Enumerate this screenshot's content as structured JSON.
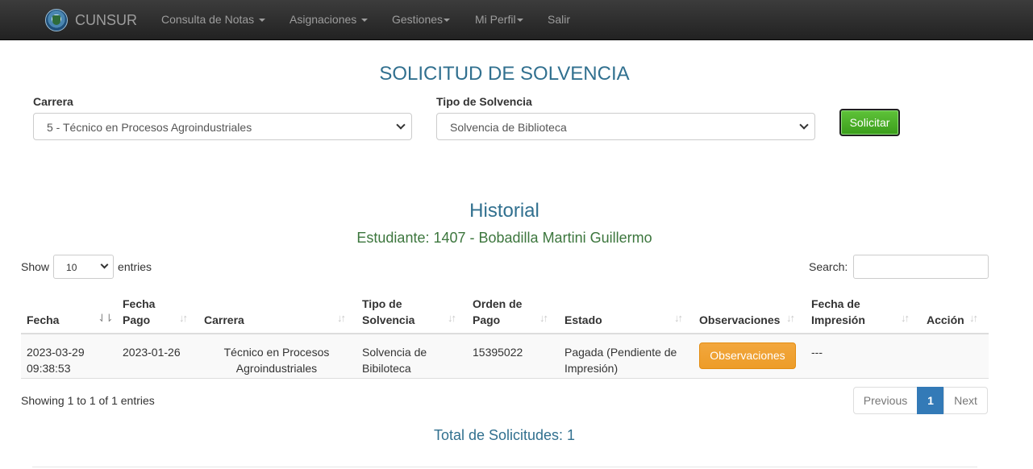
{
  "navbar": {
    "brand": "CUNSUR",
    "items": [
      {
        "label": "Consulta de Notas",
        "has_caret": true
      },
      {
        "label": "Asignaciones",
        "has_caret": true
      },
      {
        "label": "Gestiones",
        "has_caret": true
      },
      {
        "label": "Mi Perfil",
        "has_caret": true
      },
      {
        "label": "Salir",
        "has_caret": false
      }
    ]
  },
  "page_title": "SOLICITUD DE SOLVENCIA",
  "form": {
    "carrera_label": "Carrera",
    "carrera_value": "5 - Técnico en Procesos Agroindustriales",
    "tipo_label": "Tipo de Solvencia",
    "tipo_value": "Solvencia de Biblioteca",
    "submit_label": "Solicitar"
  },
  "historial": {
    "title": "Historial",
    "student": "Estudiante: 1407 - Bobadilla Martini Guillermo"
  },
  "table_controls": {
    "show_label": "Show",
    "length_value": "10",
    "entries_label": "entries",
    "search_label": "Search:",
    "search_value": ""
  },
  "table": {
    "columns": [
      {
        "line1": "",
        "line2": "Fecha"
      },
      {
        "line1": "Fecha",
        "line2": "Pago"
      },
      {
        "line1": "",
        "line2": "Carrera"
      },
      {
        "line1": "Tipo de",
        "line2": "Solvencia"
      },
      {
        "line1": "Orden de",
        "line2": "Pago"
      },
      {
        "line1": "",
        "line2": "Estado"
      },
      {
        "line1": "",
        "line2": "Observaciones"
      },
      {
        "line1": "Fecha de",
        "line2": "Impresión"
      },
      {
        "line1": "",
        "line2": "Acción"
      }
    ],
    "sorted_column": "Fecha",
    "rows": [
      {
        "fecha_l1": "2023-03-29",
        "fecha_l2": "09:38:53",
        "fecha_pago": "2023-01-26",
        "carrera_l1": "Técnico en Procesos",
        "carrera_l2": "Agroindustriales",
        "tipo_l1": "Solvencia de",
        "tipo_l2": "Bibiloteca",
        "orden": "15395022",
        "estado_l1": "Pagada (Pendiente de",
        "estado_l2": "Impresión)",
        "obs_button": "Observaciones",
        "fecha_impresion": "---",
        "accion": ""
      }
    ]
  },
  "footer": {
    "info": "Showing 1 to 1 of 1 entries",
    "prev": "Previous",
    "current_page": "1",
    "next": "Next",
    "total": "Total de Solicitudes: 1"
  },
  "colors": {
    "navbar": "#222222",
    "title_blue": "#31708f",
    "student_green": "#3c763d",
    "success_green": "#4cae2a",
    "warning_orange": "#f0ad4e",
    "pager_active": "#337ab7"
  }
}
